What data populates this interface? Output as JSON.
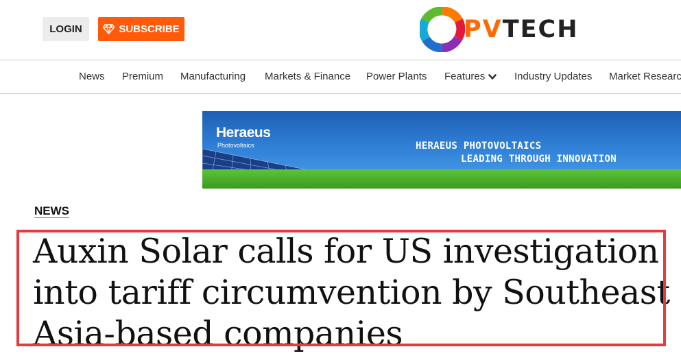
{
  "header": {
    "login_label": "LOGIN",
    "subscribe_label": "SUBSCRIBE",
    "subscribe_icon": "diamond-icon",
    "logo": {
      "text_pv": "PV",
      "text_tech": "TECH"
    }
  },
  "nav": {
    "items": [
      {
        "label": "News"
      },
      {
        "label": "Premium"
      },
      {
        "label": "Manufacturing"
      },
      {
        "label": "Markets & Finance"
      },
      {
        "label": "Power Plants"
      },
      {
        "label": "Features",
        "icon": "chevron-down-icon"
      },
      {
        "label": "Industry Updates"
      },
      {
        "label": "Market Research"
      }
    ]
  },
  "banner": {
    "brand": "Heraeus",
    "sub": "Photovoltaics",
    "line1": "HERAEUS PHOTOVOLTAICS",
    "line2": "LEADING THROUGH INNOVATION"
  },
  "article": {
    "category": "NEWS",
    "headline": "Auxin Solar calls for US investigation into tariff circumvention by Southeast Asia-based companies"
  },
  "colors": {
    "accent_orange": "#ff5a0a",
    "highlight_red": "#e8393f",
    "login_bg": "#ececec"
  }
}
